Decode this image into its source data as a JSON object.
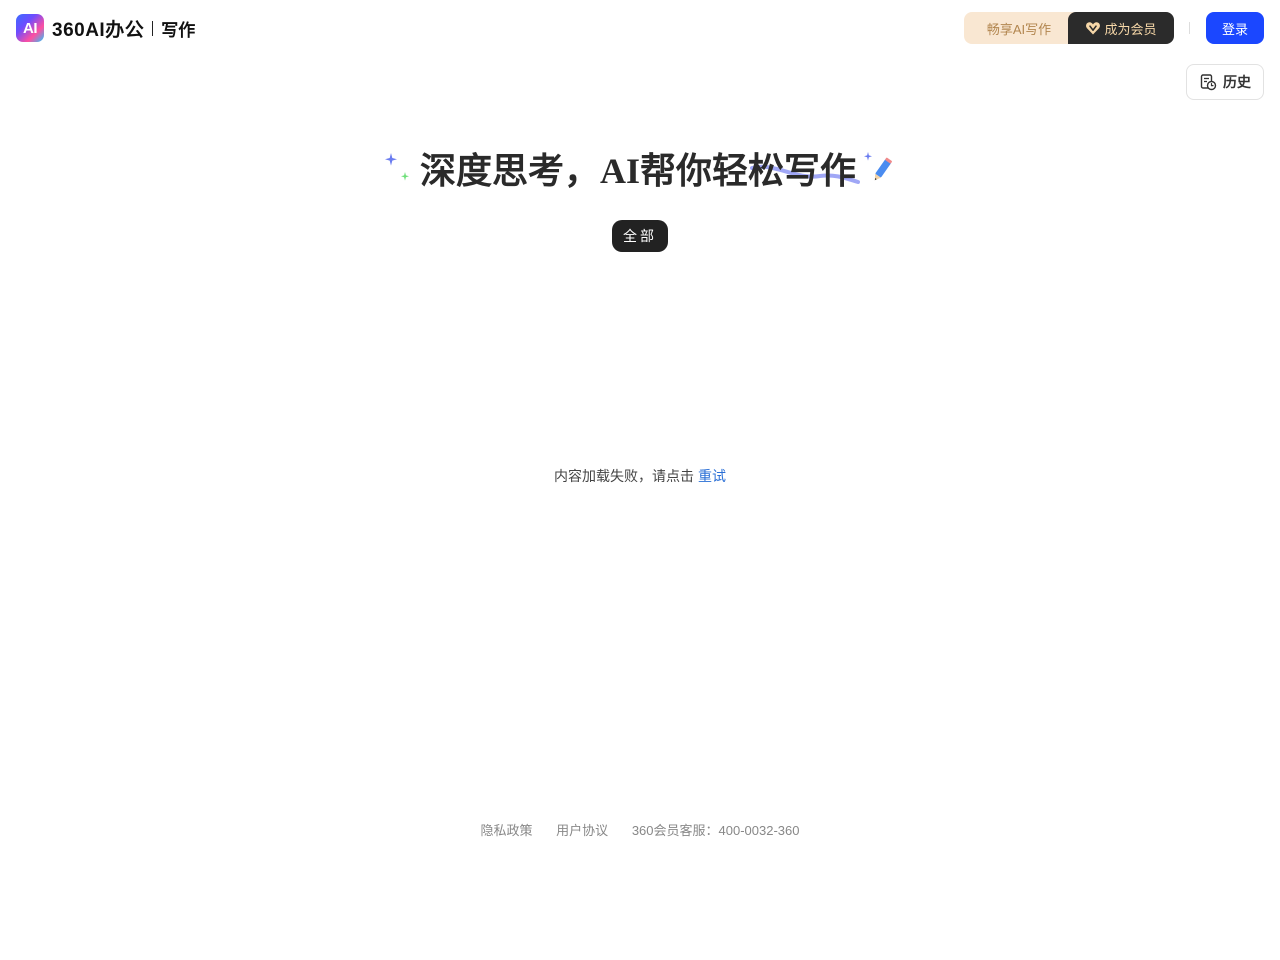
{
  "header": {
    "logo_badge": "AI",
    "brand": "360AI办公",
    "product": "写作",
    "vip_enjoy_label": "畅享AI写作",
    "vip_join_label": "成为会员",
    "login_label": "登录"
  },
  "history": {
    "label": "历史"
  },
  "hero": {
    "title": "深度思考，AI帮你轻松写作"
  },
  "filter": {
    "selected_label": "全部"
  },
  "error": {
    "message": "内容加载失败，请点击",
    "retry_label": "重试"
  },
  "footer": {
    "privacy": "隐私政策",
    "agreement": "用户协议",
    "service": "360会员客服：400-0032-360"
  },
  "colors": {
    "login_blue": "#1b47ff",
    "vip_dark": "#2b2b2b",
    "vip_light": "#f9e7d2",
    "retry_link": "#2a6fd6"
  }
}
